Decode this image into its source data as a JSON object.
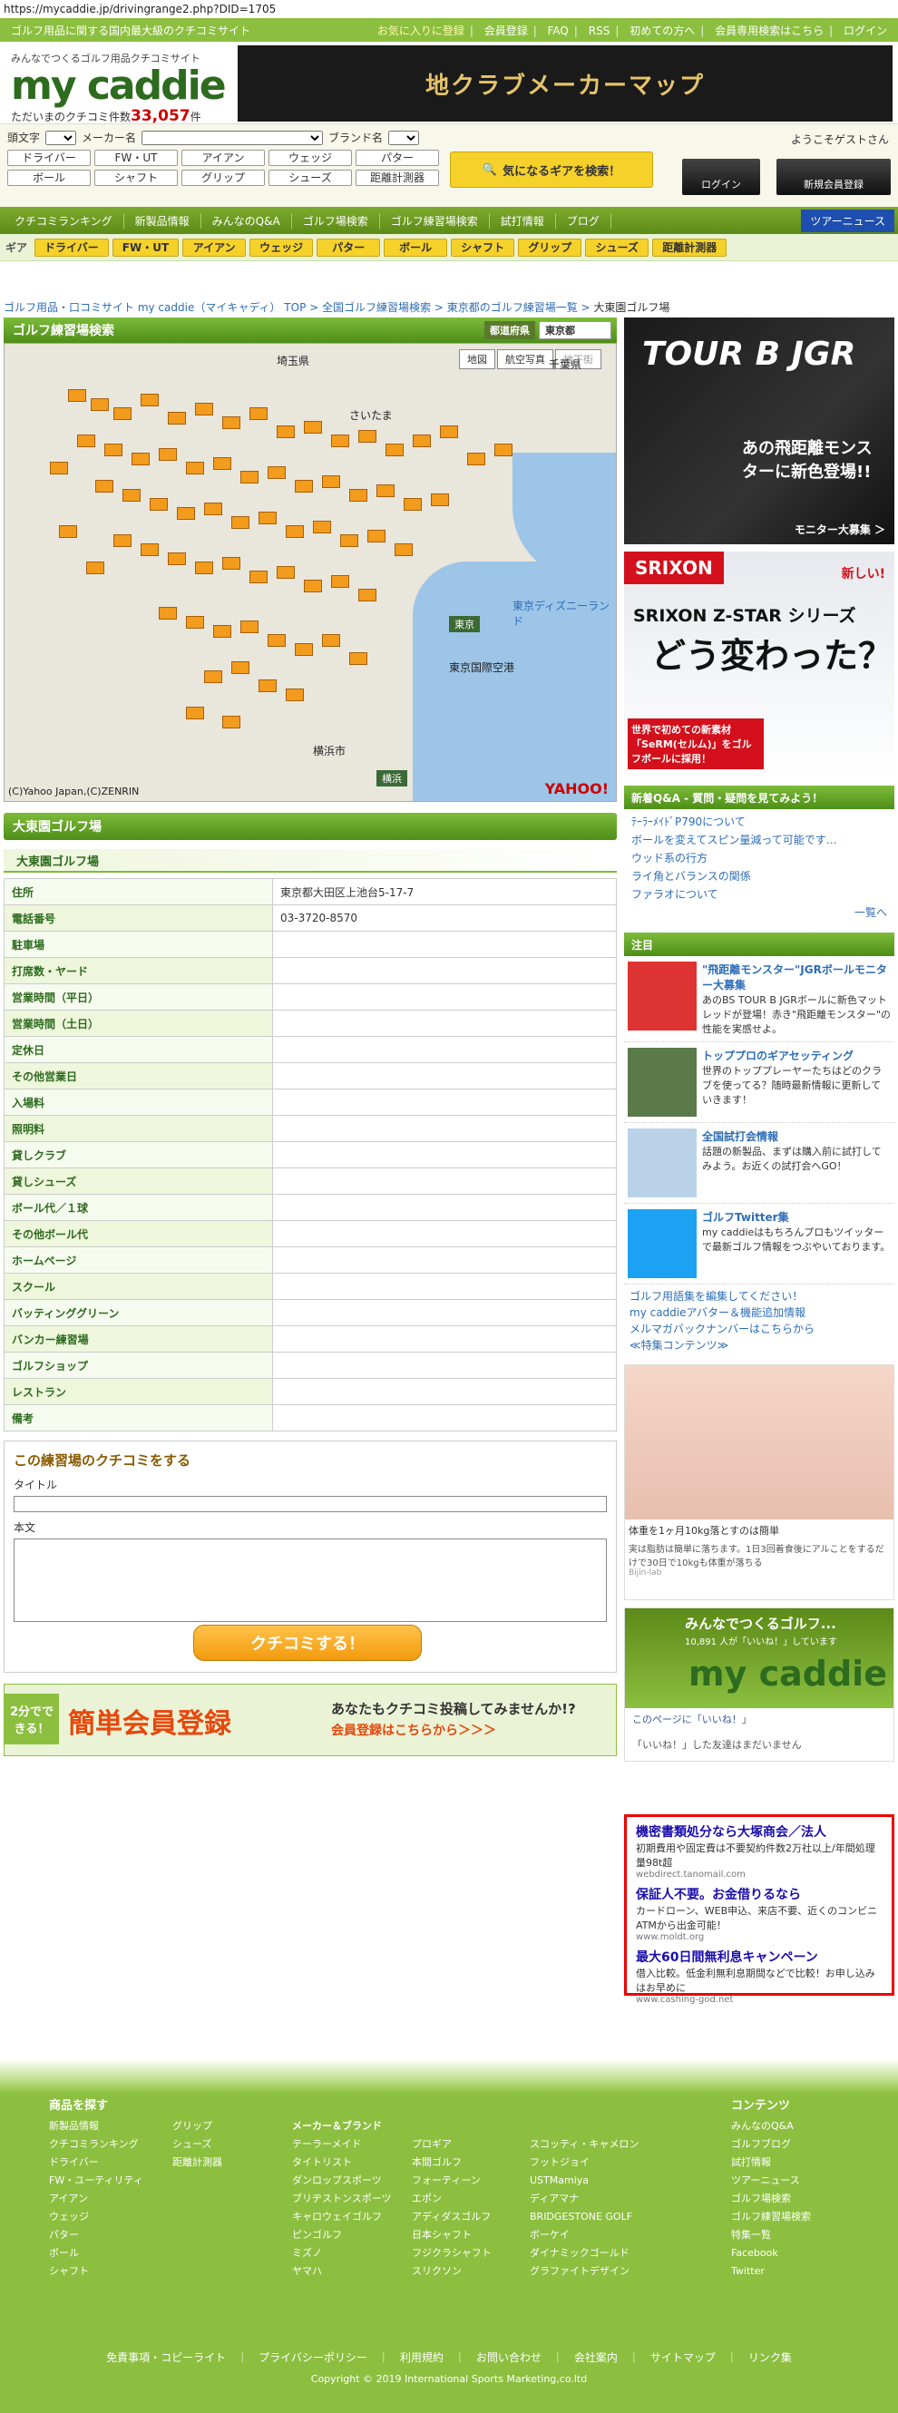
{
  "url": "https://mycaddie.jp/drivingrange2.php?DID=1705",
  "topbar": {
    "tagline": "ゴルフ用品に関する国内最大級のクチコミサイト",
    "links": [
      "お気に入りに登録",
      "会員登録",
      "FAQ",
      "RSS",
      "初めての方へ",
      "会員専用検索はこちら",
      "ログイン"
    ]
  },
  "logo": {
    "tag": "みんなでつくるゴルフ用品クチコミサイト",
    "name": "my caddie",
    "count_label": "ただいまのクチコミ件数",
    "count": "33,057",
    "count_unit": "件"
  },
  "banner": "地クラブメーカーマップ",
  "search": {
    "labels": [
      "頭文字",
      "メーカー名",
      "ブランド名"
    ],
    "buttons": [
      "ドライバー",
      "FW・UT",
      "アイアン",
      "ウェッジ",
      "パター",
      "ボール",
      "シャフト",
      "グリップ",
      "シューズ",
      "距離計測器"
    ],
    "finder": "気になるギアを検索！",
    "welcome": "ようこそゲストさん",
    "login": "ログイン",
    "register": "新規会員登録"
  },
  "nav": [
    "クチコミランキング",
    "新製品情報",
    "みんなのQ&A",
    "ゴルフ場検索",
    "ゴルフ練習場検索",
    "試打情報",
    "ブログ",
    "ツアーニュース"
  ],
  "gear": {
    "label": "ギア",
    "items": [
      "ドライバー",
      "FW・UT",
      "アイアン",
      "ウェッジ",
      "パター",
      "ボール",
      "シャフト",
      "グリップ",
      "シューズ",
      "距離計測器"
    ]
  },
  "breadcrumb": [
    "ゴルフ用品・口コミサイト my caddie（マイキャディ） TOP",
    "全国ゴルフ練習場検索",
    "東京都のゴルフ練習場一覧",
    "大東園ゴルフ場"
  ],
  "mapsec": {
    "title": "ゴルフ練習場検索",
    "pref_label": "都道府県",
    "pref": "東京都",
    "views": [
      "地図",
      "航空写真",
      "地下街"
    ],
    "labels": [
      "埼玉県",
      "千葉県",
      "さいたま",
      "東京",
      "東京国際空港",
      "横浜",
      "横浜市",
      "東京ディズニーランド"
    ],
    "copyright": "(C)Yahoo Japan,(C)ZENRIN",
    "brand": "YAHOO!"
  },
  "facility": {
    "title": "大東園ゴルフ場",
    "subtitle": "大東園ゴルフ場",
    "rows": [
      [
        "住所",
        "東京都大田区上池台5-17-7"
      ],
      [
        "電話番号",
        "03-3720-8570"
      ],
      [
        "駐車場",
        ""
      ],
      [
        "打席数・ヤード",
        ""
      ],
      [
        "営業時間（平日）",
        ""
      ],
      [
        "営業時間（土日）",
        ""
      ],
      [
        "定休日",
        ""
      ],
      [
        "その他営業日",
        ""
      ],
      [
        "入場料",
        ""
      ],
      [
        "照明料",
        ""
      ],
      [
        "貸しクラブ",
        ""
      ],
      [
        "貸しシューズ",
        ""
      ],
      [
        "ボール代／１球",
        ""
      ],
      [
        "その他ボール代",
        ""
      ],
      [
        "ホームページ",
        ""
      ],
      [
        "スクール",
        ""
      ],
      [
        "バッティンググリーン",
        ""
      ],
      [
        "バンカー練習場",
        ""
      ],
      [
        "ゴルフショップ",
        ""
      ],
      [
        "レストラン",
        ""
      ],
      [
        "備考",
        ""
      ]
    ]
  },
  "review": {
    "title": "この練習場のクチコミをする",
    "title_label": "タイトル",
    "body_label": "本文",
    "submit": "クチコミする！"
  },
  "regbanner": {
    "left": "2分でできる！",
    "main": "簡単会員登録",
    "q": "あなたもクチコミ投稿してみませんか!?",
    "link": "会員登録はこちらから＞＞＞"
  },
  "side": {
    "ad1": {
      "brand": "TOUR B JGR",
      "copy": "あの飛距離モンスターに新色登場!!",
      "cta": "モニター大募集 ＞"
    },
    "ad2": {
      "brand": "SRIXON",
      "sub": "SRIXON Z-STAR シリーズ",
      "big": "どう変わった？",
      "new": "新しい!",
      "copy": "世界で初めての新素材「SeRM(セルム)」をゴルフボールに採用！"
    },
    "qa_title": "新着Q&A - 質問・疑問を見てみよう！",
    "qa": [
      "ﾃｰﾗｰﾒｲﾄﾞP790について",
      "ボールを変えてスピン量減って可能です…",
      "ウッド系の行方",
      "ライ角とバランスの関係",
      "ファラオについて"
    ],
    "qa_more": "一覧へ",
    "notice_title": "注目",
    "notices": [
      {
        "t": "\"飛距離モンスター\"JGRボールモニター大募集",
        "d": "あのBS TOUR B JGRボールに新色マットレッドが登場！赤き\"飛距離モンスター\"の性能を実感せよ。"
      },
      {
        "t": "トッププロのギアセッティング",
        "d": "世界のトッププレーヤーたちはどのクラブを使ってる？随時最新情報に更新していきます！"
      },
      {
        "t": "全国試打会情報",
        "d": "話題の新製品、まずは購入前に試打してみよう。お近くの試打会へGO！"
      },
      {
        "t": "ゴルフTwitter集",
        "d": "my caddieはもちろんプロもツイッターで最新ゴルフ情報をつぶやいております。"
      }
    ],
    "links": [
      "ゴルフ用語集を編集してください！",
      "my caddieアバター＆機能追加情報",
      "メルマガバックナンバーはこちらから",
      "≪特集コンテンツ≫"
    ],
    "ad3": {
      "t": "体重を1ヶ月10kg落とすのは簡単",
      "d": "実は脂肪は簡単に落ちます。1日3回着食後にアルことをするだけで30日で10kgも体重が落ちる",
      "src": "Bijin-lab"
    },
    "fb": {
      "t": "みんなでつくるゴルフ...",
      "likes": "10,891 人が「いいね！」しています",
      "name": "my caddie",
      "btn": "このページに「いいね！」",
      "none": "「いいね！」した友達はまだいません"
    },
    "ad4": [
      {
        "t": "機密書類処分なら大塚商会／法人",
        "d": "初期費用や固定費は不要契約件数2万社以上/年間処理量98t超",
        "u": "webdirect.tanomail.com"
      },
      {
        "t": "保証人不要。お金借りるなら",
        "d": "カードローン、WEB申込、来店不要、近くのコンビニATMから出金可能！",
        "u": "www.moldt.org"
      },
      {
        "t": "最大60日間無利息キャンペーン",
        "d": "借入比較。低金利無利息期間などで比較！お申し込みはお早めに",
        "u": "www.cashing-god.net"
      }
    ]
  },
  "footer": {
    "h1": "商品を探す",
    "h2": "コンテンツ",
    "c1": [
      "新製品情報",
      "クチコミランキング",
      "ドライバー",
      "FW・ユーティリティ",
      "アイアン",
      "ウェッジ",
      "パター",
      "ボール",
      "シャフト"
    ],
    "c2": [
      "グリップ",
      "シューズ",
      "距離計測器"
    ],
    "c3h": "メーカー＆ブランド",
    "c3": [
      "テーラーメイド",
      "タイトリスト",
      "ダンロップスポーツ",
      "ブリヂストンスポーツ",
      "キャロウェイゴルフ",
      "ピンゴルフ",
      "ミズノ",
      "ヤマハ"
    ],
    "c4": [
      "プロギア",
      "本間ゴルフ",
      "フォーティーン",
      "エポン",
      "アディダスゴルフ",
      "日本シャフト",
      "フジクラシャフト",
      "スリクソン"
    ],
    "c5": [
      "スコッティ・キャメロン",
      "フットジョイ",
      "USTMamiya",
      "ディアマナ",
      "BRIDGESTONE GOLF",
      "ボーケイ",
      "ダイナミックゴールド",
      "グラファイトデザイン"
    ],
    "c6": [
      "みんなのQ&A",
      "ゴルフブログ",
      "試打情報",
      "ツアーニュース",
      "ゴルフ場検索",
      "ゴルフ練習場検索",
      "特集一覧",
      "Facebook",
      "Twitter"
    ],
    "links": "免責事項・コピーライト　｜　プライバシーポリシー　｜　利用規約　｜　お問い合わせ　｜　会社案内　｜　サイトマップ　｜　リンク集",
    "copyright": "Copyright © 2019 International Sports Marketing,co.ltd"
  }
}
